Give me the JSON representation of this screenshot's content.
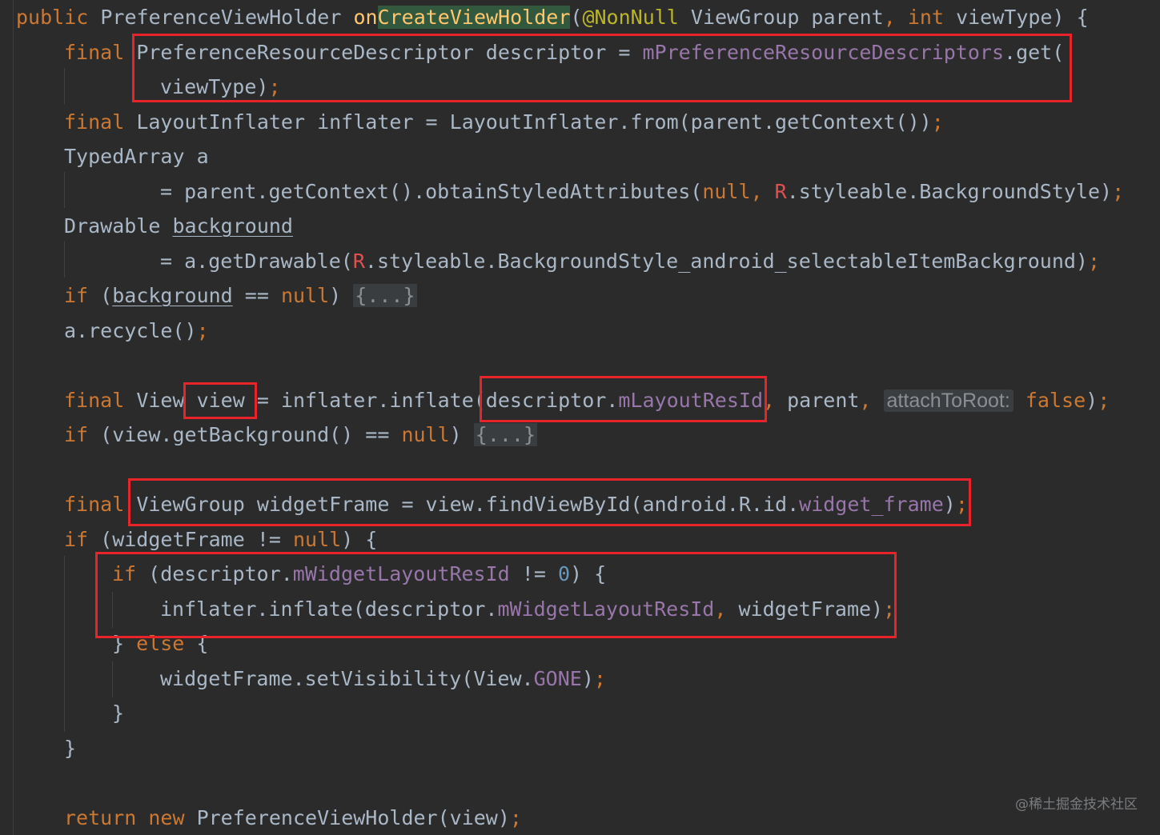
{
  "editor": {
    "language": "java",
    "theme": "Darcula",
    "colors": {
      "background": "#2b2b2b",
      "keyword": "#cc7832",
      "text": "#a9b7c6",
      "field": "#9876aa",
      "annotation": "#bbb529",
      "number": "#6897bb",
      "method_declaration": "#ffc66d",
      "highlight_box": "#e8232a"
    },
    "lines": [
      [
        [
          "kw",
          "public "
        ],
        [
          "plain",
          "PreferenceViewHolder "
        ],
        [
          "fnname",
          "on"
        ],
        [
          "fnhl",
          "CreateViewHolder"
        ],
        [
          "plain",
          "("
        ],
        [
          "ann",
          "@NonNull "
        ],
        [
          "plain",
          "ViewGroup parent"
        ],
        [
          "kw",
          ", "
        ],
        [
          "kw",
          "int "
        ],
        [
          "plain",
          "viewType) {"
        ]
      ],
      [
        [
          "kw",
          "final "
        ],
        [
          "plain",
          "PreferenceResourceDescriptor descriptor = "
        ],
        [
          "field",
          "mPreferenceResourceDescriptors"
        ],
        [
          "plain",
          ".get("
        ]
      ],
      [
        [
          "plain",
          "viewType)"
        ],
        [
          "kw",
          ";"
        ]
      ],
      [
        [
          "kw",
          "final "
        ],
        [
          "plain",
          "LayoutInflater inflater = LayoutInflater."
        ],
        [
          "plain",
          "from(parent.getContext())"
        ],
        [
          "kw",
          ";"
        ]
      ],
      [
        [
          "plain",
          "TypedArray a"
        ]
      ],
      [
        [
          "plain",
          "= parent.getContext().obtainStyledAttributes("
        ],
        [
          "kw",
          "null"
        ],
        [
          "kw",
          ", "
        ],
        [
          "rcls",
          "R"
        ],
        [
          "plain",
          ".styleable.BackgroundStyle)"
        ],
        [
          "kw",
          ";"
        ]
      ],
      [
        [
          "plain",
          "Drawable "
        ],
        [
          "ul",
          "background"
        ]
      ],
      [
        [
          "plain",
          "= a.getDrawable("
        ],
        [
          "rcls",
          "R"
        ],
        [
          "plain",
          ".styleable.BackgroundStyle_android_selectableItemBackground)"
        ],
        [
          "kw",
          ";"
        ]
      ],
      [
        [
          "kw",
          "if "
        ],
        [
          "plain",
          "("
        ],
        [
          "ul",
          "background"
        ],
        [
          "plain",
          " == "
        ],
        [
          "kw",
          "null"
        ],
        [
          "plain",
          ") "
        ],
        [
          "fold",
          "{...}"
        ]
      ],
      [
        [
          "plain",
          "a.recycle()"
        ],
        [
          "kw",
          ";"
        ]
      ],
      [
        [
          "kw",
          "final "
        ],
        [
          "plain",
          "View view = inflater.inflate(descriptor."
        ],
        [
          "field",
          "mLayoutResId"
        ],
        [
          "kw",
          ", "
        ],
        [
          "plain",
          "parent"
        ],
        [
          "kw",
          ", "
        ],
        [
          "hint",
          "attachToRoot:"
        ],
        [
          "plain",
          " "
        ],
        [
          "kw",
          "false"
        ],
        [
          "plain",
          ")"
        ],
        [
          "kw",
          ";"
        ]
      ],
      [
        [
          "kw",
          "if "
        ],
        [
          "plain",
          "(view.getBackground() == "
        ],
        [
          "kw",
          "null"
        ],
        [
          "plain",
          ") "
        ],
        [
          "fold",
          "{...}"
        ]
      ],
      [
        [
          "kw",
          "final "
        ],
        [
          "plain",
          "ViewGroup widgetFrame = view.findViewById(android.R.id."
        ],
        [
          "field",
          "widget_frame"
        ],
        [
          "plain",
          ")"
        ],
        [
          "kw",
          ";"
        ]
      ],
      [
        [
          "kw",
          "if "
        ],
        [
          "plain",
          "(widgetFrame != "
        ],
        [
          "kw",
          "null"
        ],
        [
          "plain",
          ") {"
        ]
      ],
      [
        [
          "kw",
          "if "
        ],
        [
          "plain",
          "(descriptor."
        ],
        [
          "field",
          "mWidgetLayoutResId"
        ],
        [
          "plain",
          " != "
        ],
        [
          "num",
          "0"
        ],
        [
          "plain",
          ") {"
        ]
      ],
      [
        [
          "plain",
          "inflater.inflate(descriptor."
        ],
        [
          "field",
          "mWidgetLayoutResId"
        ],
        [
          "kw",
          ", "
        ],
        [
          "plain",
          "widgetFrame)"
        ],
        [
          "kw",
          ";"
        ]
      ],
      [
        [
          "plain",
          "} "
        ],
        [
          "kw",
          "else "
        ],
        [
          "plain",
          "{"
        ]
      ],
      [
        [
          "plain",
          "widgetFrame.setVisibility(View."
        ],
        [
          "field",
          "GONE"
        ],
        [
          "plain",
          ")"
        ],
        [
          "kw",
          ";"
        ]
      ],
      [
        [
          "plain",
          "}"
        ]
      ],
      [
        [
          "plain",
          "}"
        ]
      ],
      [
        [
          "kw",
          "return "
        ],
        [
          "kw",
          "new "
        ],
        [
          "plain",
          "PreferenceViewHolder(view)"
        ],
        [
          "kw",
          ";"
        ]
      ]
    ]
  },
  "watermark": "@稀土掘金技术社区"
}
